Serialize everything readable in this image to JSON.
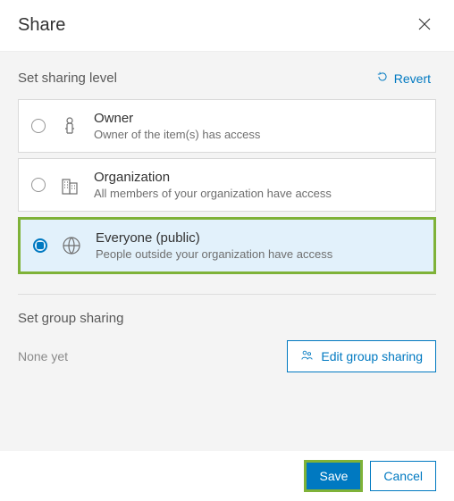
{
  "header": {
    "title": "Share"
  },
  "sharing_level": {
    "title": "Set sharing level",
    "revert_label": "Revert",
    "options": [
      {
        "title": "Owner",
        "desc": "Owner of the item(s) has access",
        "selected": false
      },
      {
        "title": "Organization",
        "desc": "All members of your organization have access",
        "selected": false
      },
      {
        "title": "Everyone (public)",
        "desc": "People outside your organization have access",
        "selected": true
      }
    ]
  },
  "group_sharing": {
    "title": "Set group sharing",
    "empty_text": "None yet",
    "edit_label": "Edit group sharing"
  },
  "footer": {
    "save_label": "Save",
    "cancel_label": "Cancel"
  }
}
